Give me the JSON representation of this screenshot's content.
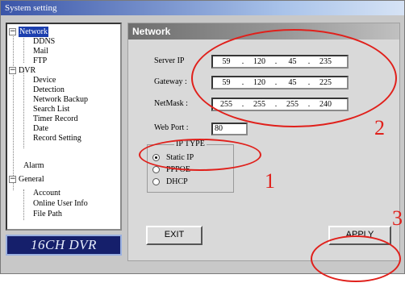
{
  "window": {
    "title": "System setting"
  },
  "tree": {
    "groups": [
      {
        "label": "Network",
        "selected": true,
        "children": [
          "DDNS",
          "Mail",
          "FTP"
        ]
      },
      {
        "label": "DVR",
        "children": [
          "Device",
          "Detection",
          "Network Backup",
          "Search List",
          "Timer Record",
          "Date",
          "Record Setting"
        ]
      },
      {
        "label": "Alarm",
        "children": []
      },
      {
        "label": "General",
        "children": [
          "Account",
          "Online User Info",
          "File Path"
        ]
      }
    ],
    "toggle_minus": "−"
  },
  "logo": {
    "text": "16CH DVR"
  },
  "panel": {
    "header": "Network",
    "server_ip": {
      "label": "Server IP",
      "octets": [
        "59",
        "120",
        "45",
        "235"
      ]
    },
    "gateway": {
      "label": "Gateway :",
      "octets": [
        "59",
        "120",
        "45",
        "225"
      ]
    },
    "netmask": {
      "label": "NetMask :",
      "octets": [
        "255",
        "255",
        "255",
        "240"
      ]
    },
    "web_port": {
      "label": "Web Port :",
      "value": "80"
    },
    "ip_type": {
      "title": "IP TYPE",
      "options": [
        {
          "label": "Static IP",
          "checked": true
        },
        {
          "label": "PPPOE",
          "checked": false
        },
        {
          "label": "DHCP",
          "checked": false
        }
      ]
    },
    "exit_label": "EXIT",
    "apply_label": "APPLY"
  },
  "annotations": {
    "labels": [
      "1",
      "2",
      "3"
    ],
    "color": "#e0201b"
  }
}
